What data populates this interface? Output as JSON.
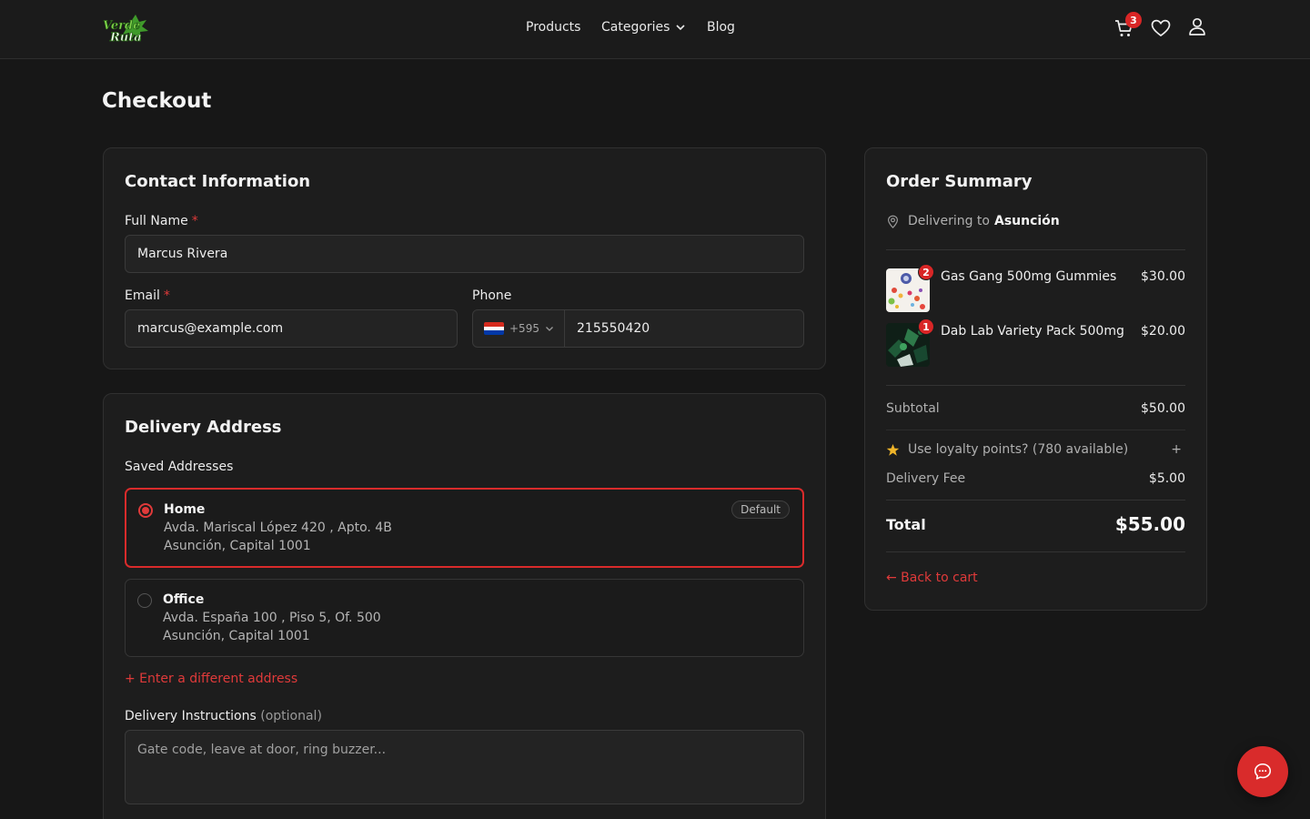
{
  "brand": {
    "logo_text_line1": "Verde",
    "logo_text_line2": "Ruta",
    "accent": "#d92b2b",
    "logo_green": "#4caf2e"
  },
  "nav": {
    "products": "Products",
    "categories": "Categories",
    "blog": "Blog",
    "cart_count": "3",
    "icons": [
      "cart-icon",
      "heart-icon",
      "user-icon"
    ]
  },
  "page": {
    "title": "Checkout"
  },
  "contact": {
    "title": "Contact Information",
    "full_name_label": "Full Name",
    "full_name_value": "Marcus Rivera",
    "email_label": "Email",
    "email_value": "marcus@example.com",
    "phone_label": "Phone",
    "country_code": "+595",
    "phone_value": "215550420",
    "required_mark": "*"
  },
  "delivery": {
    "title": "Delivery Address",
    "saved_label": "Saved Addresses",
    "addresses": [
      {
        "name": "Home",
        "line1": "Avda. Mariscal López 420 , Apto. 4B",
        "line2": "Asunción, Capital 1001",
        "badge": "Default",
        "selected": true
      },
      {
        "name": "Office",
        "line1": "Avda. España 100 , Piso 5, Of. 500",
        "line2": "Asunción, Capital 1001",
        "selected": false
      }
    ],
    "different_address": "+ Enter a different address",
    "instructions_label": "Delivery Instructions",
    "instructions_optional": "(optional)",
    "instructions_placeholder": "Gate code, leave at door, ring buzzer..."
  },
  "summary": {
    "title": "Order Summary",
    "delivering_prefix": "Delivering to",
    "delivering_city": "Asunción",
    "items": [
      {
        "name": "Gas Gang 500mg Gummies",
        "price": "$30.00",
        "qty": "2"
      },
      {
        "name": "Dab Lab Variety Pack 500mg",
        "price": "$20.00",
        "qty": "1"
      }
    ],
    "subtotal_label": "Subtotal",
    "subtotal_value": "$50.00",
    "loyalty_text": "Use loyalty points? (780 available)",
    "loyalty_toggle": "+",
    "delivery_fee_label": "Delivery Fee",
    "delivery_fee_value": "$5.00",
    "total_label": "Total",
    "total_value": "$55.00",
    "back_link": "← Back to cart"
  }
}
